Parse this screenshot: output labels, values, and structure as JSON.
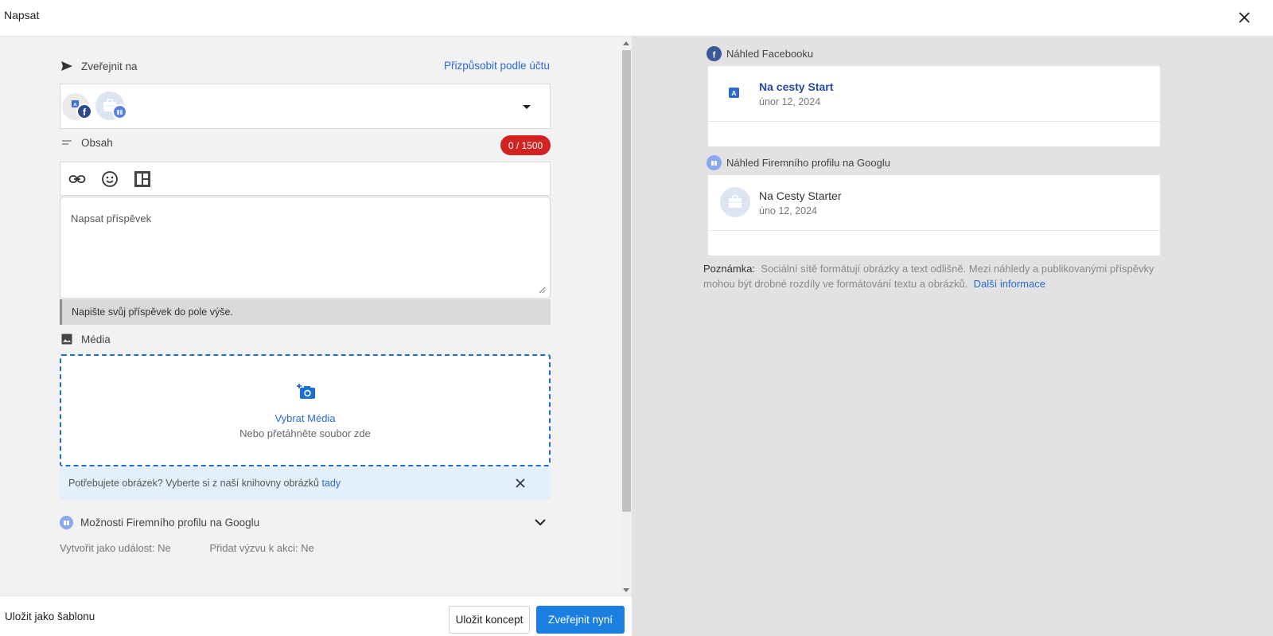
{
  "header": {
    "title": "Napsat",
    "close_icon": "close-icon"
  },
  "compose": {
    "publish_to": {
      "label": "Zveřejnit na",
      "customize_link": "Přizpůsobit podle účtu"
    },
    "content": {
      "label": "Obsah",
      "counter": "0 / 1500",
      "placeholder": "Napsat příspěvek",
      "hint": "Napište svůj příspěvek do pole výše."
    },
    "toolbar": {
      "link_icon": "link-icon",
      "emoji_icon": "emoji-icon",
      "layout_icon": "layout-icon"
    },
    "media": {
      "label": "Média",
      "select": "Vybrat Média",
      "drag": "Nebo přetáhněte soubor zde"
    },
    "banner": {
      "text": "Potřebujete obrázek? Vyberte si z naší knihovny obrázků",
      "link": "tady"
    },
    "gbp_options": {
      "label": "Možnosti Firemního profilu na Googlu",
      "event": "Vytvořit jako událost: Ne",
      "cta": "Přidat výzvu k akci: Ne"
    }
  },
  "footer": {
    "save_template": "Uložit jako šablonu",
    "save_draft": "Uložit koncept",
    "publish_now": "Zveřejnit nyní"
  },
  "preview": {
    "facebook": {
      "label": "Náhled Facebooku",
      "name": "Na cesty Start",
      "date": "únor 12, 2024"
    },
    "google": {
      "label": "Náhled Firemního profilu na Googlu",
      "name": "Na Cesty Starter",
      "date": "úno 12, 2024"
    },
    "note": {
      "prefix": "Poznámka:",
      "text": "Sociální sítě formátují obrázky a text odlišně. Mezi náhledy a publikovanými příspěvky mohou být drobné rozdíly ve formátování textu a obrázků.",
      "link": "Další informace"
    }
  },
  "colors": {
    "accent": "#1a7fe0",
    "link": "#2a6ad1",
    "counter_bg": "#d32222",
    "facebook": "#3b5998",
    "google_profile": "#5b7fe0"
  }
}
